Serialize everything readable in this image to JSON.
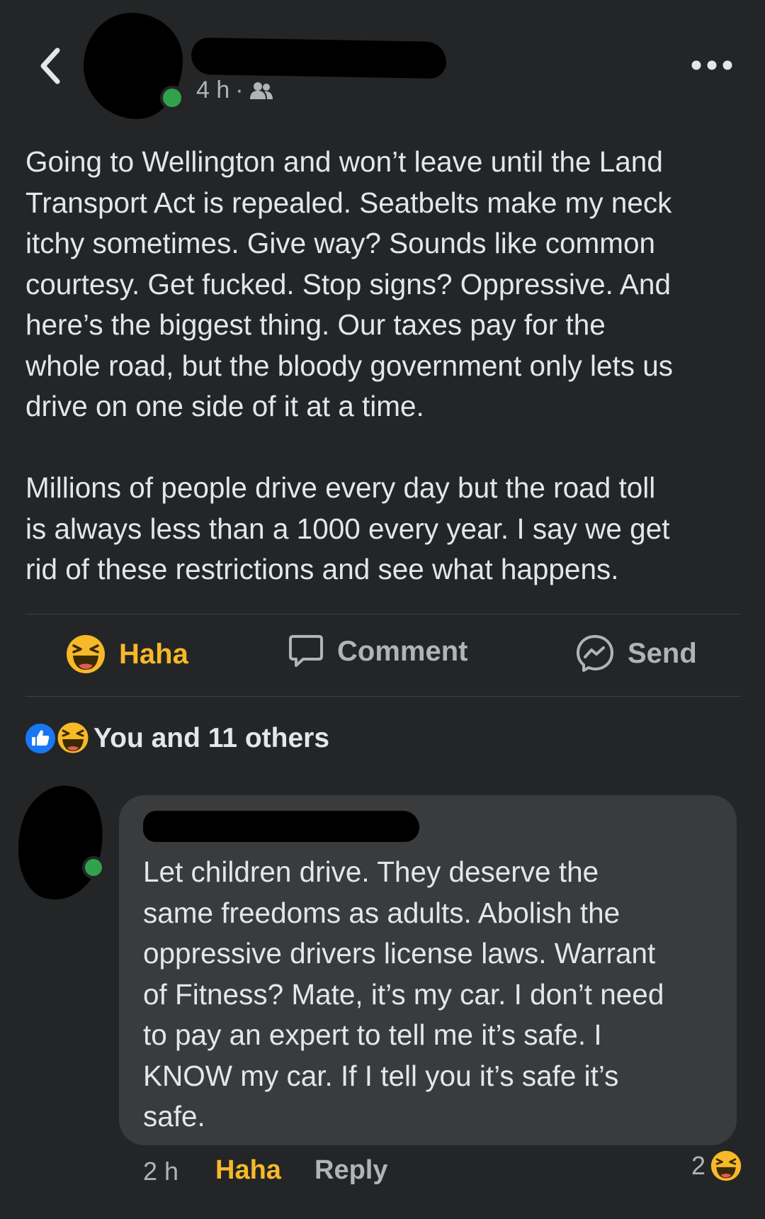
{
  "post": {
    "time": "4 h",
    "separator": "·",
    "audience_icon": "friends-icon",
    "paragraphs": [
      "Going to Wellington and won’t leave until the Land\nTransport Act is repealed. Seatbelts make my neck\nitchy sometimes. Give way? Sounds like common\ncourtesy. Get fucked. Stop signs? Oppressive. And\nhere’s the biggest thing. Our taxes pay for the\nwhole road, but the bloody government only lets us\ndrive on one side of it at a time.",
      "Millions of people drive every day but the road toll\nis always less than a 1000 every year. I say we get\nrid of these restrictions and see what happens."
    ]
  },
  "actions": {
    "haha_label": "Haha",
    "comment_label": "Comment",
    "send_label": "Send"
  },
  "reactions": {
    "summary": "You and 11 others",
    "icons": [
      "like-icon",
      "haha-icon"
    ]
  },
  "comment": {
    "text": "Let children drive. They deserve the\nsame freedoms as adults. Abolish the\noppressive drivers license laws. Warrant\nof Fitness? Mate, it’s my car. I don’t need\nto pay an expert to tell me it’s safe. I\nKNOW my car. If I tell you it’s safe it’s\nsafe.",
    "time": "2 h",
    "haha_label": "Haha",
    "reply_label": "Reply",
    "reaction_count": "2"
  },
  "colors": {
    "background": "#242526",
    "bubble": "#3a3b3c",
    "text_primary": "#e4e6eb",
    "text_secondary": "#b0b3b8",
    "haha_yellow": "#f7b928",
    "like_blue": "#1877f2",
    "online_green": "#31a24c"
  }
}
